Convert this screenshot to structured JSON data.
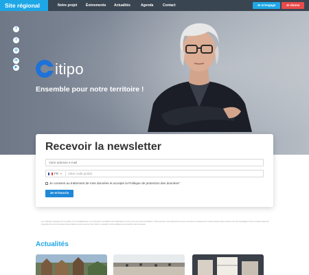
{
  "header": {
    "brand": "Site régional",
    "nav": [
      "Notre projet",
      "Événements",
      "Actualités",
      "Agenda",
      "Contact"
    ],
    "engage_label": "Je m'engage",
    "donate_label": "Je donne"
  },
  "colors": {
    "brand_blue": "#1ea7e6",
    "nav_bg": "#3a4552",
    "donate_red": "#e94b4b",
    "logo_blue": "#1e72d8"
  },
  "hero": {
    "social_icons": [
      "facebook-icon",
      "twitter-icon",
      "instagram-icon",
      "linkedin-icon",
      "youtube-icon"
    ],
    "logo_text": "itipo",
    "tagline": "Ensemble pour notre territoire !"
  },
  "newsletter": {
    "title": "Recevoir la newsletter",
    "email_placeholder": "Votre adresse e-mail",
    "country_code": "FR",
    "phone_placeholder": "Votre code postal",
    "consent_text": "Je consens au traitement de mes données et accepte la Politique de protection des données*",
    "submit_label": "Je m'inscris"
  },
  "disclaimer": "Les champs marqués d'une étoile (*) sont obligatoires. Les données recueillies sont destinées à l'envoi de nos communications. Vous pouvez vous désinscrire à tout moment en cliquant sur le lien présent dans chacun de nos messages. Pour en savoir plus sur la gestion de vos données personnelles et pour exercer vos droits, consultez notre politique de protection des données.",
  "news": {
    "title": "Actualités"
  }
}
